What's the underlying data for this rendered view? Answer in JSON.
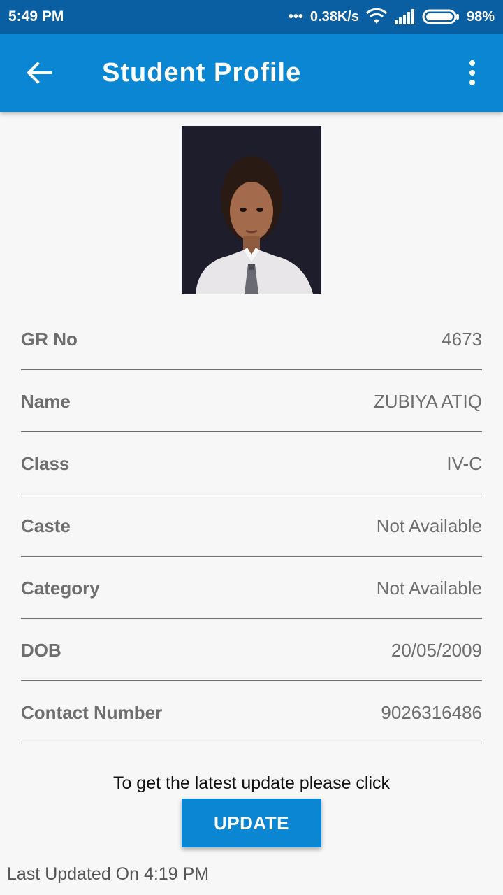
{
  "status_bar": {
    "time": "5:49 PM",
    "speed": "0.38K/s",
    "battery": "98%"
  },
  "app_bar": {
    "title": "Student Profile",
    "back_icon": "arrow-back-icon",
    "menu_icon": "more-vert-icon"
  },
  "profile": {
    "photo_alt": "student-photo",
    "rows": [
      {
        "label": "GR No",
        "value": "4673"
      },
      {
        "label": "Name",
        "value": "ZUBIYA ATIQ"
      },
      {
        "label": "Class",
        "value": "IV-C"
      },
      {
        "label": "Caste",
        "value": "Not Available"
      },
      {
        "label": "Category",
        "value": "Not Available"
      },
      {
        "label": "DOB",
        "value": "20/05/2009"
      },
      {
        "label": "Contact Number",
        "value": "9026316486"
      }
    ]
  },
  "update": {
    "hint": "To get the latest update please click",
    "button_label": "UPDATE",
    "last_updated": "Last Updated On 4:19 PM"
  },
  "colors": {
    "status_bar": "#0a5fa3",
    "app_bar": "#0b86d2",
    "button": "#0b86d2"
  }
}
